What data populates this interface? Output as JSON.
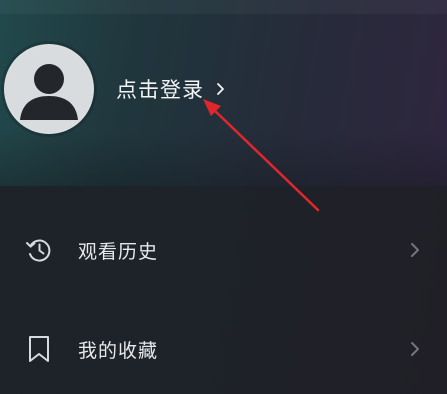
{
  "profile": {
    "login_label": "点击登录",
    "avatar_icon": "user-avatar-icon",
    "chevron_icon": "chevron-right-icon"
  },
  "menu": {
    "items": [
      {
        "label": "观看历史",
        "icon": "history-icon"
      },
      {
        "label": "我的收藏",
        "icon": "bookmark-icon"
      }
    ]
  },
  "colors": {
    "text_primary": "#f2f4f6",
    "chevron": "#6f767e",
    "annotation_arrow": "#e0272c"
  }
}
